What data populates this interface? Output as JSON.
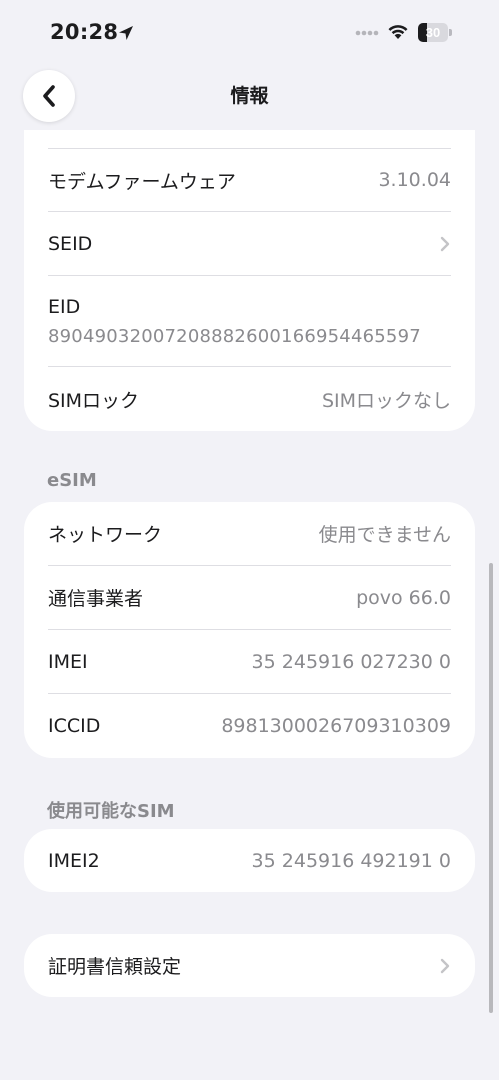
{
  "status_bar": {
    "time": "20:28",
    "battery": "30",
    "battery_level_percent": 30,
    "icons": [
      "location-arrow-icon",
      "signal-dots-icon",
      "wifi-icon",
      "battery-icon"
    ]
  },
  "nav": {
    "title": "情報",
    "back_icon": "chevron-left-icon"
  },
  "top_card": {
    "rows": [
      {
        "label": "モデムファームウェア",
        "value": "3.10.04"
      },
      {
        "label": "SEID",
        "value": ""
      },
      {
        "label": "EID",
        "value": "89049032007208882600166954465597"
      },
      {
        "label": "SIMロック",
        "value": "SIMロックなし"
      }
    ]
  },
  "esim": {
    "header": "eSIM",
    "rows": [
      {
        "label": "ネットワーク",
        "value": "使用できません"
      },
      {
        "label": "通信事業者",
        "value": "povo 66.0"
      },
      {
        "label": "IMEI",
        "value": "35 245916 027230 0"
      },
      {
        "label": "ICCID",
        "value": "8981300026709310309"
      }
    ]
  },
  "available_sim": {
    "header": "使用可能なSIM",
    "rows": [
      {
        "label": "IMEI2",
        "value": "35 245916 492191 0"
      }
    ]
  },
  "cert_card": {
    "label": "証明書信頼設定"
  },
  "colors": {
    "background": "#f2f2f7",
    "card": "#ffffff",
    "secondary_text": "#8a8a8e",
    "chevron": "#c4c4c7"
  }
}
